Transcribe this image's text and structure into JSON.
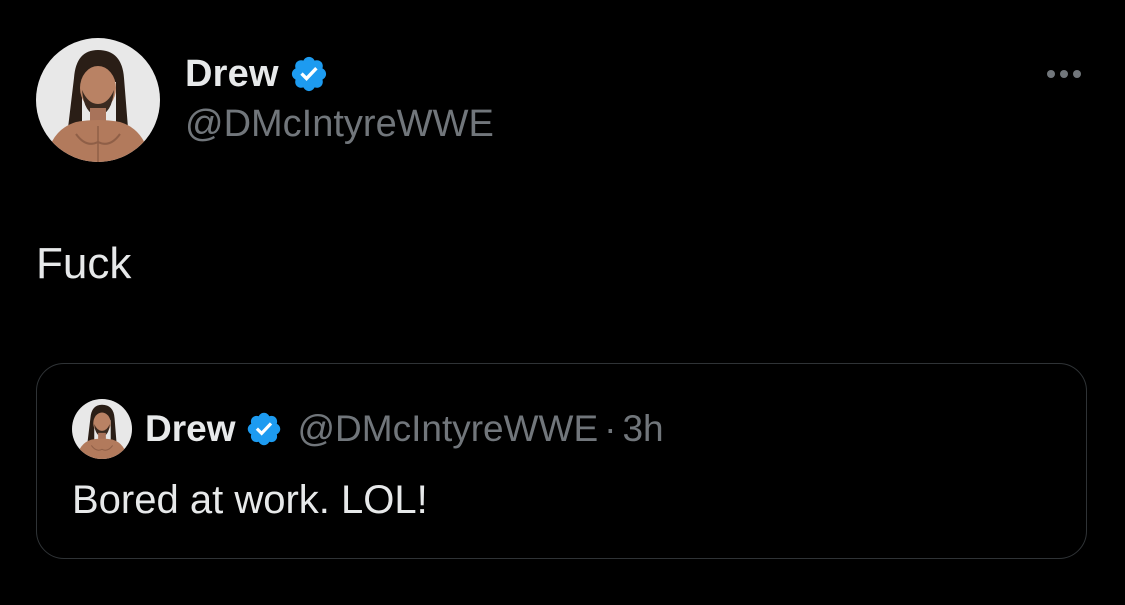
{
  "colors": {
    "background": "#000000",
    "primary_text": "#e7e9ea",
    "secondary_text": "#71767b",
    "verified_blue": "#1d9bf0",
    "card_border": "#2f3336"
  },
  "tweet": {
    "author": {
      "display_name": "Drew",
      "handle": "@DMcIntyreWWE",
      "avatar_icon": "avatar-image",
      "verified_icon": "verified-badge-icon"
    },
    "more_icon": "more-options-icon",
    "text": "Fuck"
  },
  "quoted_tweet": {
    "author": {
      "display_name": "Drew",
      "handle": "@DMcIntyreWWE",
      "avatar_icon": "avatar-image",
      "verified_icon": "verified-badge-icon"
    },
    "separator": "·",
    "time": "3h",
    "text": "Bored at work. LOL!"
  }
}
